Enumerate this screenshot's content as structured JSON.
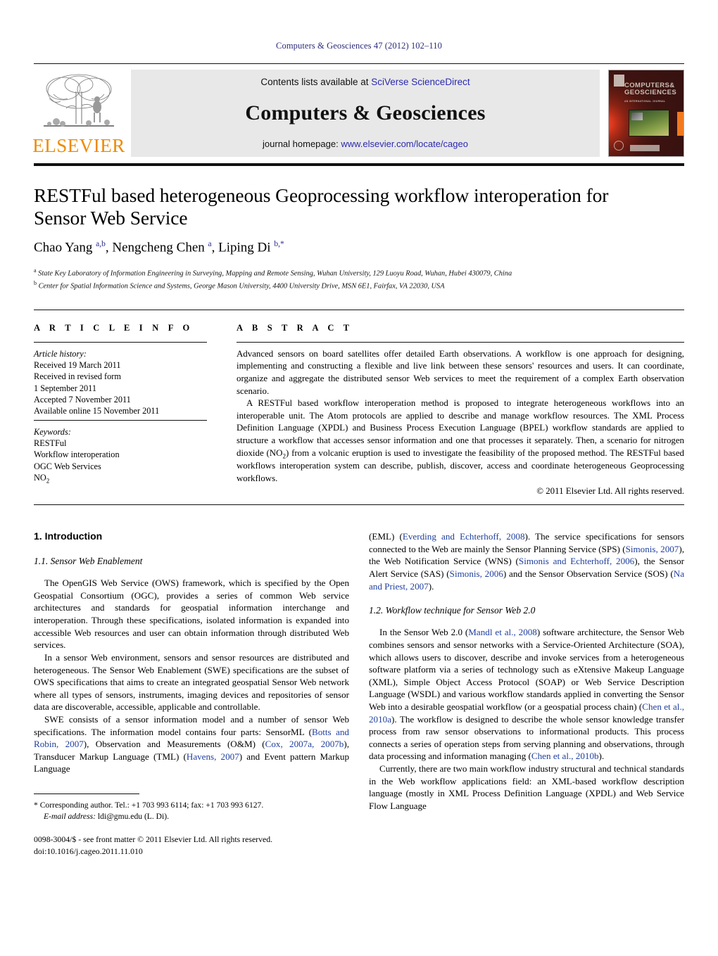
{
  "running_head": "Computers & Geosciences 47 (2012) 102–110",
  "header": {
    "contents_prefix": "Contents lists available at ",
    "contents_link": "SciVerse ScienceDirect",
    "journal_title": "Computers & Geosciences",
    "homepage_prefix": "journal homepage: ",
    "homepage_url": "www.elsevier.com/locate/cageo",
    "publisher_logo_text": "ELSEVIER",
    "cover_title_line1": "COMPUTERS&",
    "cover_title_line2": "GEOSCIENCES",
    "cover_subtitle": "AN INTERNATIONAL JOURNAL"
  },
  "title": {
    "main": "RESTFul based heterogeneous Geoprocessing workflow interoperation for Sensor Web Service",
    "authors_html": "Chao Yang <sup>a,b</sup>, Nengcheng Chen <sup>a</sup>, Liping Di <sup>b,*</sup>",
    "affiliation_a": "State Key Laboratory of Information Engineering in Surveying, Mapping and Remote Sensing, Wuhan University, 129 Luoyu Road, Wuhan, Hubei 430079, China",
    "affiliation_b": "Center for Spatial Information Science and Systems, George Mason University, 4400 University Drive, MSN 6E1, Fairfax, VA 22030, USA",
    "affil_marker_a": "a",
    "affil_marker_b": "b"
  },
  "article_info": {
    "heading": "A R T I C L E   I N F O",
    "history_label": "Article history:",
    "history": [
      "Received 19 March 2011",
      "Received in revised form",
      "1 September 2011",
      "Accepted 7 November 2011",
      "Available online 15 November 2011"
    ],
    "keywords_label": "Keywords:",
    "keywords": [
      "RESTFul",
      "Workflow interoperation",
      "OGC Web Services",
      "NO2"
    ]
  },
  "abstract": {
    "heading": "A B S T R A C T",
    "paragraph_1": "Advanced sensors on board satellites offer detailed Earth observations. A workflow is one approach for designing, implementing and constructing a flexible and live link between these sensors' resources and users. It can coordinate, organize and aggregate the distributed sensor Web services to meet the requirement of a complex Earth observation scenario.",
    "paragraph_2_a": "A RESTFul based workflow interoperation method is proposed to integrate heterogeneous workflows into an interoperable unit. The Atom protocols are applied to describe and manage workflow resources. The XML Process Definition Language (XPDL) and Business Process Execution Language (BPEL) workflow standards are applied to structure a workflow that accesses sensor information and one that processes it separately. Then, a scenario for nitrogen dioxide (NO",
    "paragraph_2_sub": "2",
    "paragraph_2_b": ") from a volcanic eruption is used to investigate the feasibility of the proposed method. The RESTFul based workflows interoperation system can describe, publish, discover, access and coordinate heterogeneous Geoprocessing workflows.",
    "copyright": "© 2011 Elsevier Ltd. All rights reserved."
  },
  "body": {
    "section_1": "1.  Introduction",
    "subsection_1_1": "1.1.  Sensor Web Enablement",
    "subsection_1_2": "1.2.  Workflow technique for Sensor Web 2.0",
    "left": {
      "p1": "The OpenGIS Web Service (OWS) framework, which is specified by the Open Geospatial Consortium (OGC), provides a series of common Web service architectures and standards for geospatial information interchange and interoperation. Through these specifications, isolated information is expanded into accessible Web resources and user can obtain information through distributed Web services.",
      "p2": "In a sensor Web environment, sensors and sensor resources are distributed and heterogeneous. The Sensor Web Enablement (SWE) specifications are the subset of OWS specifications that aims to create an integrated geospatial Sensor Web network where all types of sensors, instruments, imaging devices and repositories of sensor data are discoverable, accessible, applicable and controllable.",
      "p3_a": "SWE consists of a sensor information model and a number of sensor Web specifications. The information model contains four parts: SensorML (",
      "p3_ref1": "Botts and Robin, 2007",
      "p3_b": "), Observation and Measurements (O&M) (",
      "p3_ref2": "Cox, 2007a, 2007b",
      "p3_c": "), Transducer Markup Language (TML) (",
      "p3_ref3": "Havens, 2007",
      "p3_d": ") and Event pattern Markup Language"
    },
    "right": {
      "p1_a": "(EML) (",
      "p1_ref1": "Everding and Echterhoff, 2008",
      "p1_b": "). The service specifications for sensors connected to the Web are mainly the Sensor Planning Service (SPS) (",
      "p1_ref2": "Simonis, 2007",
      "p1_c": "), the Web Notification Service (WNS) (",
      "p1_ref3": "Simonis and Echterhoff, 2006",
      "p1_d": "), the Sensor Alert Service (SAS) (",
      "p1_ref4": "Simonis, 2006",
      "p1_e": ") and the Sensor Observation Service (SOS) (",
      "p1_ref5": "Na and Priest, 2007",
      "p1_f": ").",
      "p2_a": "In the Sensor Web 2.0 (",
      "p2_ref1": "Mandl et al., 2008",
      "p2_b": ") software architecture, the Sensor Web combines sensors and sensor networks with a Service-Oriented Architecture (SOA), which allows users to discover, describe and invoke services from a heterogeneous software platform via a series of technology such as eXtensive Makeup Language (XML), Simple Object Access Protocol (SOAP) or Web Service Description Language (WSDL) and various workflow standards applied in converting the Sensor Web into a desirable geospatial workflow (or a geospatial process chain) (",
      "p2_ref2": "Chen et al., 2010a",
      "p2_c": "). The workflow is designed to describe the whole sensor knowledge transfer process from raw sensor observations to informational products. This process connects a series of operation steps from serving planning and observations, through data processing and information managing (",
      "p2_ref3": "Chen et al., 2010b",
      "p2_d": ").",
      "p3": "Currently, there are two main workflow industry structural and technical standards in the Web workflow applications field: an XML-based workflow description language (mostly in XML Process Definition Language (XPDL) and Web Service Flow Language"
    }
  },
  "footnote": {
    "corresponding": "* Corresponding author. Tel.: +1 703 993 6114; fax: +1 703 993 6127.",
    "email_label": "E-mail address:",
    "email": "ldi@gmu.edu (L. Di).",
    "issn_line": "0098-3004/$ - see front matter © 2011 Elsevier Ltd. All rights reserved.",
    "doi_line": "doi:10.1016/j.cageo.2011.11.010"
  },
  "colors": {
    "link": "#1f3f9e",
    "running_head": "#2b2b7a",
    "elsevier_orange": "#ED8B00",
    "header_band_bg": "#e8e8e8"
  }
}
